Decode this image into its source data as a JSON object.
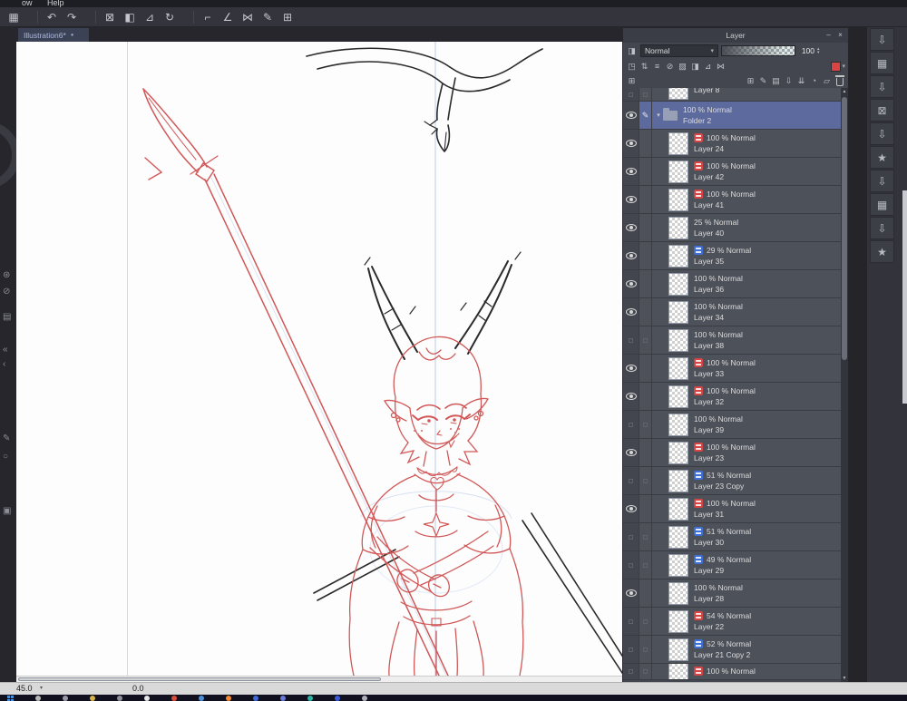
{
  "menu": {
    "items": [
      "ow",
      "Help"
    ]
  },
  "toolbar": {
    "icons": [
      {
        "name": "app-grid-icon",
        "glyph": "▦"
      },
      {
        "spacer": true
      },
      {
        "name": "undo-icon",
        "glyph": "↶"
      },
      {
        "name": "redo-icon",
        "glyph": "↷"
      },
      {
        "spacer": true
      },
      {
        "name": "deselect-icon",
        "glyph": "⊠"
      },
      {
        "name": "fill-icon",
        "glyph": "◧"
      },
      {
        "name": "transform-icon",
        "glyph": "⊿"
      },
      {
        "name": "rotate-view-icon",
        "glyph": "↻"
      },
      {
        "spacer": true
      },
      {
        "name": "ruler-icon",
        "glyph": "⌐"
      },
      {
        "name": "set-square-icon",
        "glyph": "∠"
      },
      {
        "name": "symmetry-ruler-icon",
        "glyph": "⋈"
      },
      {
        "name": "pen-ruler-icon",
        "glyph": "✎"
      },
      {
        "name": "grid-icon",
        "glyph": "⊞"
      }
    ]
  },
  "document_tab": {
    "label": "Illustration6*",
    "modified_dot": "●"
  },
  "left_toolbar": {
    "icons": [
      {
        "name": "auto-select-icon",
        "glyph": "⊛"
      },
      {
        "name": "clear-icon",
        "glyph": "⊘"
      },
      {
        "name": "folder-tray-icon",
        "glyph": "▤"
      },
      {
        "name": "collapse-double-chevron-icon",
        "glyph": "«"
      },
      {
        "name": "collapse-chevron-icon",
        "glyph": "‹"
      },
      {
        "name": "pen-tool-icon",
        "glyph": "✎"
      },
      {
        "name": "magnifier-icon",
        "glyph": "○"
      },
      {
        "name": "swatch-icon",
        "glyph": "▣"
      }
    ]
  },
  "canvas": {
    "sketch_color": "#d15858",
    "ink_color": "#2a2a2a",
    "guide_color": "#b9cdea"
  },
  "layer_panel": {
    "title": "Layer",
    "minimize_glyph": "–",
    "close_glyph": "×",
    "blend_mode": "Normal",
    "blend_caret": "▾",
    "opacity_value": "100",
    "spinner_up": "▴",
    "spinner_down": "▾",
    "fold_arrow": "▾",
    "pencil_glyph": "✎",
    "scroll_up": "▲",
    "scroll_down": "▼",
    "layer_color_swatch": "#d84343",
    "header_icons_row1": [
      {
        "name": "clipping-icon",
        "glyph": "◳"
      },
      {
        "name": "reference-layer-icon",
        "glyph": "⇅"
      },
      {
        "name": "two-pane-icon",
        "glyph": "≡"
      },
      {
        "name": "lock-layer-icon",
        "glyph": "⊘"
      },
      {
        "name": "lock-transparent-icon",
        "glyph": "▨"
      },
      {
        "name": "enable-mask-icon",
        "glyph": "◨"
      },
      {
        "name": "ruler-snap-icon",
        "glyph": "⊿"
      },
      {
        "name": "link-icon",
        "glyph": "⋈"
      }
    ],
    "header_row2_left_icon": {
      "name": "panel-grid-icon",
      "glyph": "⊞"
    },
    "header_icons_row2": [
      {
        "name": "new-raster-layer-icon",
        "glyph": "⊞"
      },
      {
        "name": "new-vector-layer-icon",
        "glyph": "✎"
      },
      {
        "name": "new-folder-icon",
        "glyph": "▤"
      },
      {
        "name": "transfer-down-icon",
        "glyph": "⇩"
      },
      {
        "name": "merge-down-icon",
        "glyph": "⇊"
      },
      {
        "name": "create-mask-icon",
        "glyph": "◔"
      },
      {
        "name": "divide-frame-icon",
        "glyph": "▱"
      },
      {
        "name": "delete-layer-icon",
        "glyph": "",
        "css": "trash"
      }
    ],
    "layers": [
      {
        "info": "",
        "name": "Layer 8",
        "badge": "none",
        "visible": false,
        "selected": false,
        "type": "layer",
        "partial": "top"
      },
      {
        "info": "100 % Normal",
        "name": "Folder 2",
        "badge": "none",
        "visible": true,
        "selected": true,
        "type": "folder"
      },
      {
        "info": "100 % Normal",
        "name": "Layer 24",
        "badge": "red",
        "visible": true,
        "selected": false,
        "type": "layer"
      },
      {
        "info": "100 % Normal",
        "name": "Layer 42",
        "badge": "red",
        "visible": true,
        "selected": false,
        "type": "layer"
      },
      {
        "info": "100 % Normal",
        "name": "Layer 41",
        "badge": "red",
        "visible": true,
        "selected": false,
        "type": "layer"
      },
      {
        "info": "25 % Normal",
        "name": "Layer 40",
        "badge": "none",
        "visible": true,
        "selected": false,
        "type": "layer"
      },
      {
        "info": "29 % Normal",
        "name": "Layer 35",
        "badge": "blue",
        "visible": true,
        "selected": false,
        "type": "layer"
      },
      {
        "info": "100 % Normal",
        "name": "Layer 36",
        "badge": "none",
        "visible": true,
        "selected": false,
        "type": "layer"
      },
      {
        "info": "100 % Normal",
        "name": "Layer 34",
        "badge": "none",
        "visible": true,
        "selected": false,
        "type": "layer"
      },
      {
        "info": "100 % Normal",
        "name": "Layer 38",
        "badge": "none",
        "visible": false,
        "selected": false,
        "type": "layer"
      },
      {
        "info": "100 % Normal",
        "name": "Layer 33",
        "badge": "red",
        "visible": true,
        "selected": false,
        "type": "layer"
      },
      {
        "info": "100 % Normal",
        "name": "Layer 32",
        "badge": "red",
        "visible": true,
        "selected": false,
        "type": "layer"
      },
      {
        "info": "100 % Normal",
        "name": "Layer 39",
        "badge": "none",
        "visible": false,
        "selected": false,
        "type": "layer"
      },
      {
        "info": "100 % Normal",
        "name": "Layer 23",
        "badge": "red",
        "visible": true,
        "selected": false,
        "type": "layer"
      },
      {
        "info": "51 % Normal",
        "name": "Layer 23 Copy",
        "badge": "blue",
        "visible": false,
        "selected": false,
        "type": "layer"
      },
      {
        "info": "100 % Normal",
        "name": "Layer 31",
        "badge": "red",
        "visible": true,
        "selected": false,
        "type": "layer"
      },
      {
        "info": "51 % Normal",
        "name": "Layer 30",
        "badge": "blue",
        "visible": false,
        "selected": false,
        "type": "layer"
      },
      {
        "info": "49 % Normal",
        "name": "Layer 29",
        "badge": "blue",
        "visible": false,
        "selected": false,
        "type": "layer"
      },
      {
        "info": "100 % Normal",
        "name": "Layer 28",
        "badge": "none",
        "visible": true,
        "selected": false,
        "type": "layer"
      },
      {
        "info": "54 % Normal",
        "name": "Layer 22",
        "badge": "red",
        "visible": false,
        "selected": false,
        "type": "layer"
      },
      {
        "info": "52 % Normal",
        "name": "Layer 21 Copy 2",
        "badge": "blue",
        "visible": false,
        "selected": false,
        "type": "layer"
      },
      {
        "info": "100 % Normal",
        "name": "",
        "badge": "red",
        "visible": false,
        "selected": false,
        "type": "layer",
        "partial": "bottom"
      }
    ]
  },
  "right_dock": {
    "buttons": [
      {
        "name": "dock-button-1",
        "icon": "box-arrow-icon",
        "glyph": "⇩"
      },
      {
        "name": "dock-button-2",
        "icon": "grid-panel-icon",
        "glyph": "▦"
      },
      {
        "name": "dock-button-3",
        "icon": "box-arrow-icon",
        "glyph": "⇩"
      },
      {
        "name": "dock-button-4",
        "icon": "x-box-icon",
        "glyph": "⊠"
      },
      {
        "name": "dock-button-5",
        "icon": "box-arrow-icon",
        "glyph": "⇩"
      },
      {
        "name": "dock-button-6",
        "icon": "star-icon",
        "glyph": "★"
      },
      {
        "name": "dock-button-7",
        "icon": "box-arrow-icon",
        "glyph": "⇩"
      },
      {
        "name": "dock-button-8",
        "icon": "grid-panel-icon",
        "glyph": "▦"
      },
      {
        "name": "dock-button-9",
        "icon": "box-arrow-icon",
        "glyph": "⇩"
      },
      {
        "name": "dock-button-10",
        "icon": "star-icon",
        "glyph": "★"
      }
    ]
  },
  "status_bar": {
    "rotation_value": "45.0",
    "caret": "▾",
    "position_value": "0.0"
  },
  "taskbar": {
    "items": [
      {
        "name": "start-button",
        "color": "#4a90d9"
      },
      {
        "name": "search-icon",
        "color": "#b8b8b8"
      },
      {
        "name": "task-view-icon",
        "color": "#9a9aa6"
      },
      {
        "name": "file-explorer-icon",
        "color": "#d9b44a"
      },
      {
        "name": "app-icon-1",
        "color": "#8f8f9a"
      },
      {
        "name": "app-icon-2",
        "color": "#e6e6e6"
      },
      {
        "name": "chrome-icon",
        "color": "#dd4b39"
      },
      {
        "name": "app-icon-3",
        "color": "#4a90d9"
      },
      {
        "name": "firefox-icon",
        "color": "#f28b30"
      },
      {
        "name": "app-icon-4",
        "color": "#3f68d9"
      },
      {
        "name": "discord-icon",
        "color": "#6b79d9"
      },
      {
        "name": "app-icon-5",
        "color": "#2bb3a3"
      },
      {
        "name": "app-icon-6",
        "color": "#3a5bd9"
      },
      {
        "name": "app-icon-7",
        "color": "#b0b0b8"
      }
    ]
  }
}
